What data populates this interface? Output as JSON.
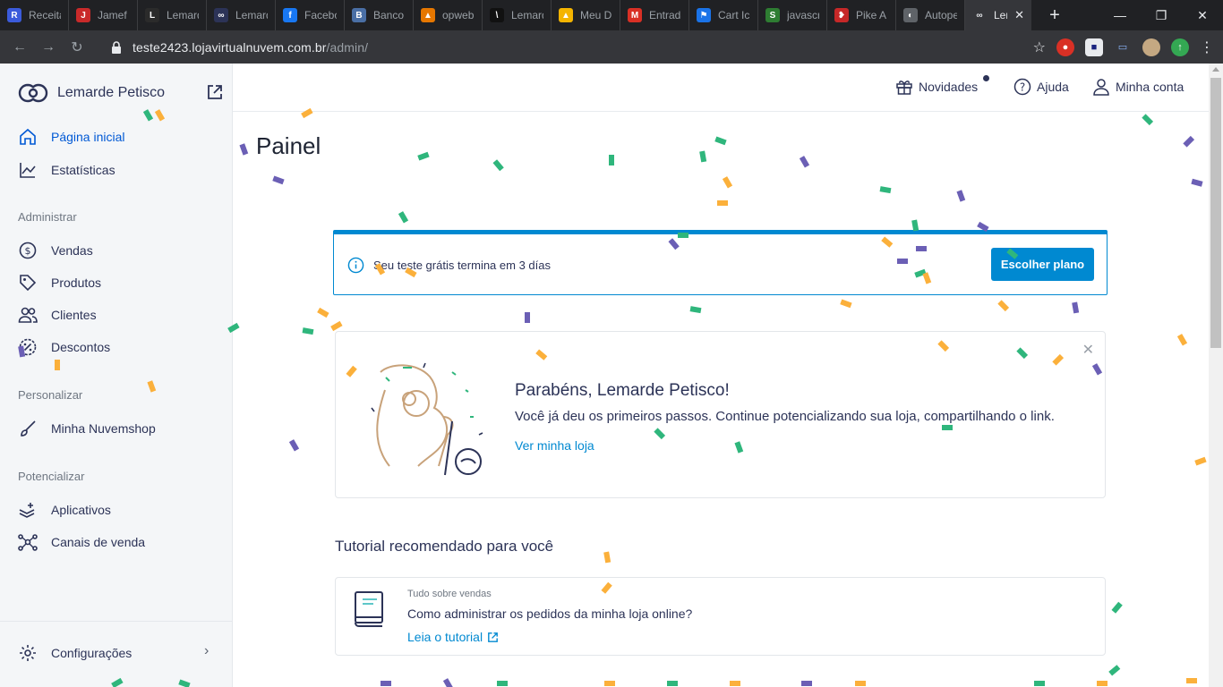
{
  "browser": {
    "tabs": [
      {
        "label": "Receita",
        "color": "#3b5bdb",
        "glyph": "R"
      },
      {
        "label": "Jamef",
        "color": "#c92a2a",
        "glyph": "J"
      },
      {
        "label": "Lemarde",
        "color": "#2b2b2b",
        "glyph": "L"
      },
      {
        "label": "Lemarde",
        "color": "#2c3357",
        "glyph": "∞"
      },
      {
        "label": "Facebook",
        "color": "#1877f2",
        "glyph": "f"
      },
      {
        "label": "Banco",
        "color": "#4a6fa5",
        "glyph": "B"
      },
      {
        "label": "opweb",
        "color": "#e67700",
        "glyph": "▲"
      },
      {
        "label": "Lemarde",
        "color": "#111111",
        "glyph": "\\"
      },
      {
        "label": "Meu Drive",
        "color": "#f4b400",
        "glyph": "▲"
      },
      {
        "label": "Entrada",
        "color": "#d93025",
        "glyph": "M"
      },
      {
        "label": "Cart Ic",
        "color": "#1a73e8",
        "glyph": "⚑"
      },
      {
        "label": "javascript",
        "color": "#2e7d32",
        "glyph": "S"
      },
      {
        "label": "Pike A",
        "color": "#c62828",
        "glyph": "❥"
      },
      {
        "label": "Autopeças",
        "color": "#5f6368",
        "glyph": "◐"
      }
    ],
    "active_tab": {
      "label": "Lemarde",
      "glyph": "∞"
    },
    "url_host": "teste2423.lojavirtualnuvem.com.br",
    "url_path": "/admin/"
  },
  "sidebar": {
    "store_name": "Lemarde Petisco",
    "items": {
      "home": "Página inicial",
      "stats": "Estatísticas",
      "sales": "Vendas",
      "products": "Produtos",
      "clients": "Clientes",
      "discounts": "Descontos",
      "my_store": "Minha Nuvemshop",
      "apps": "Aplicativos",
      "channels": "Canais de venda",
      "settings": "Configurações"
    },
    "sections": {
      "manage": "Administrar",
      "customize": "Personalizar",
      "boost": "Potencializar"
    }
  },
  "topbar": {
    "news": "Novidades",
    "help": "Ajuda",
    "account": "Minha conta"
  },
  "main": {
    "title": "Painel",
    "trial": {
      "text": "Seu teste grátis termina em 3 días",
      "button": "Escolher plano"
    },
    "congrats": {
      "title": "Parabéns, Lemarde Petisco!",
      "text": "Você já deu os primeiros passos. Continue potencializando sua loja, compartilhando o link.",
      "link": "Ver minha loja"
    },
    "tutorial": {
      "heading": "Tutorial recomendado para você",
      "category": "Tudo sobre vendas",
      "title": "Como administrar os pedidos da minha loja online?",
      "link": "Leia o tutorial"
    }
  },
  "colors": {
    "accent": "#0089d1",
    "active_nav": "#0059d5",
    "text": "#2c3357",
    "confetti": [
      "#2fb67c",
      "#fbb03b",
      "#6b5fb5"
    ]
  }
}
